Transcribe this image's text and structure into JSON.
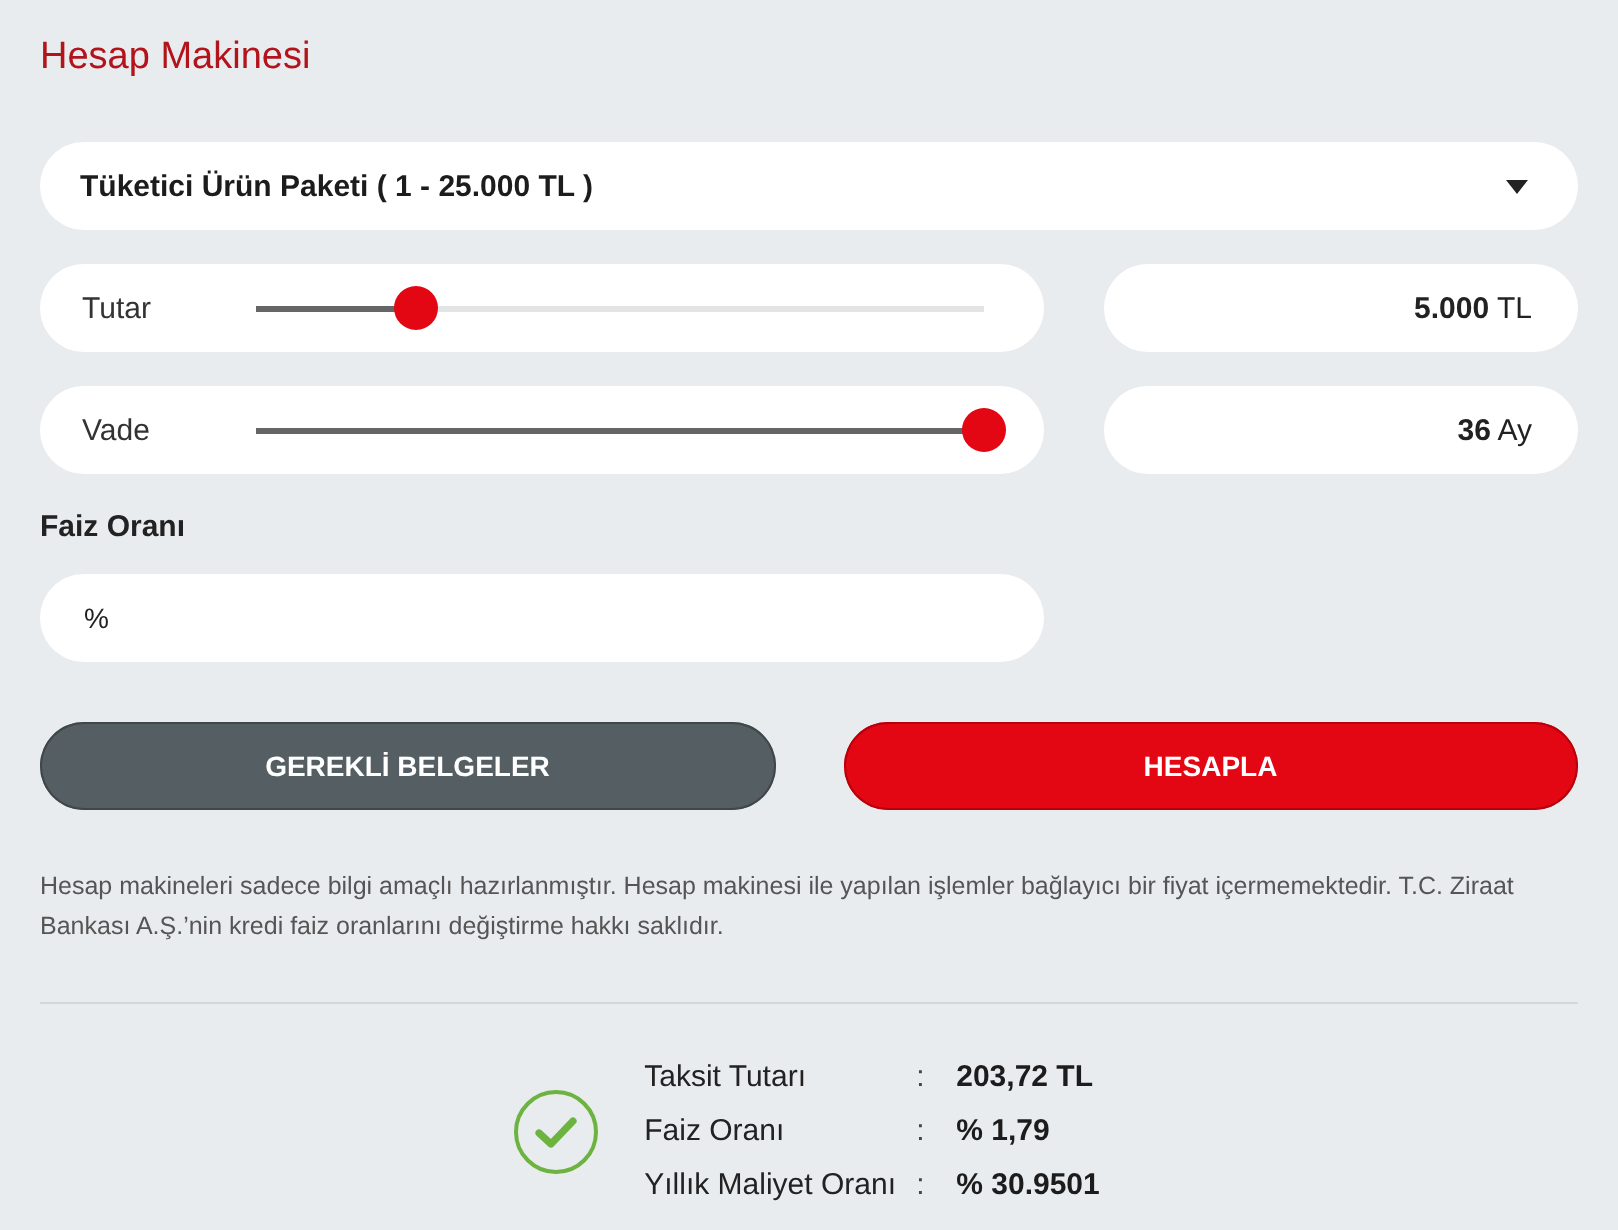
{
  "title": "Hesap Makinesi",
  "product_select": {
    "value": "Tüketici Ürün Paketi ( 1 - 25.000 TL )"
  },
  "sliders": [
    {
      "label": "Tutar",
      "level": 0.22,
      "value": "**5.000** TL"
    },
    {
      "label": "Vade",
      "level": 1,
      "value": "**36** Ay"
    }
  ],
  "rate_field": {
    "label": "Faiz Oranı",
    "value": "%"
  },
  "buttons": [
    {
      "label": "GEREKLİ BELGELER",
      "kind": "secondary"
    },
    {
      "label": "HESAPLA",
      "kind": "primary"
    }
  ],
  "disclaimer": "Hesap makineleri sadece bilgi amaçlı hazırlanmıştır. Hesap makinesi ile yapılan işlemler bağlayıcı bir fiyat içermemektedir. T.C. Ziraat Bankası A.Ş.’nin kredi faiz oranlarını değiştirme hakkı saklıdır.",
  "result": {
    "rows": [
      {
        "label": "Taksit Tutarı",
        "separator": ":",
        "value": "203,72 TL"
      },
      {
        "label": "Faiz Oranı",
        "separator": ":",
        "value": "% 1,79"
      },
      {
        "label": "Yıllık Maliyet Oranı",
        "separator": ":",
        "value": "% 30.9501"
      }
    ]
  }
}
